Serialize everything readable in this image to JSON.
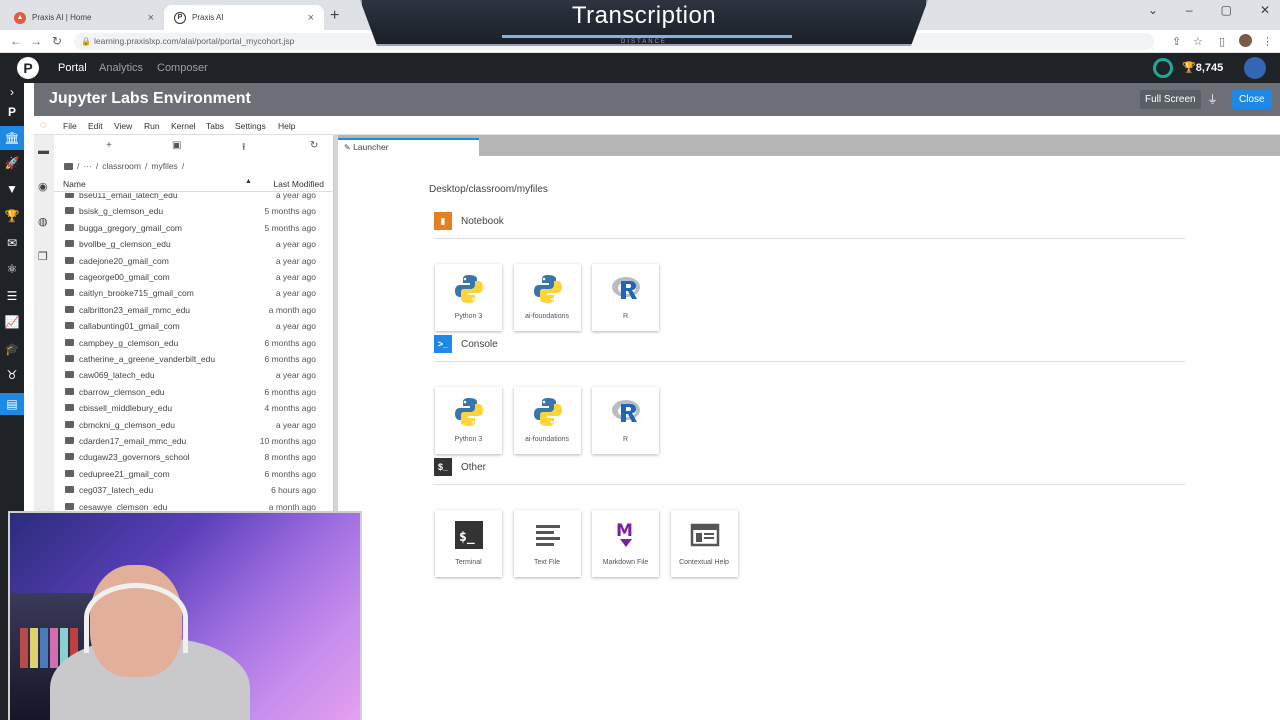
{
  "browser": {
    "tabs": [
      {
        "title": "Praxis AI | Home",
        "active": false
      },
      {
        "title": "Praxis AI",
        "active": true
      }
    ],
    "url": "learning.praxislxp.com/alai/portal/portal_mycohort.jsp"
  },
  "overlay": {
    "title": "Transcription",
    "subtitle": "DISTANCE"
  },
  "portal": {
    "logo": "P",
    "nav": [
      {
        "label": "Portal",
        "active": true
      },
      {
        "label": "Analytics",
        "active": false
      },
      {
        "label": "Composer",
        "active": false
      }
    ],
    "points": "8,745"
  },
  "jupyter": {
    "title": "Jupyter Labs Environment",
    "full_screen_label": "Full Screen",
    "close_label": "Close",
    "menu": [
      "File",
      "Edit",
      "View",
      "Run",
      "Kernel",
      "Tabs",
      "Settings",
      "Help"
    ],
    "breadcrumbs": [
      "/",
      "···",
      "/",
      "classroom",
      "/",
      "myfiles",
      "/"
    ],
    "columns": {
      "name": "Name",
      "modified": "Last Modified"
    },
    "files": [
      {
        "name": "bse011_email_latech_edu",
        "modified": "a year ago"
      },
      {
        "name": "bsisk_g_clemson_edu",
        "modified": "5 months ago"
      },
      {
        "name": "bugga_gregory_gmail_com",
        "modified": "5 months ago"
      },
      {
        "name": "bvollbe_g_clemson_edu",
        "modified": "a year ago"
      },
      {
        "name": "cadejone20_gmail_com",
        "modified": "a year ago"
      },
      {
        "name": "cageorge00_gmail_com",
        "modified": "a year ago"
      },
      {
        "name": "caitlyn_brooke715_gmail_com",
        "modified": "a year ago"
      },
      {
        "name": "calbritton23_email_mmc_edu",
        "modified": "a month ago"
      },
      {
        "name": "callabunting01_gmail_com",
        "modified": "a year ago"
      },
      {
        "name": "campbey_g_clemson_edu",
        "modified": "6 months ago"
      },
      {
        "name": "catherine_a_greene_vanderbilt_edu",
        "modified": "6 months ago"
      },
      {
        "name": "caw069_latech_edu",
        "modified": "a year ago"
      },
      {
        "name": "cbarrow_clemson_edu",
        "modified": "6 months ago"
      },
      {
        "name": "cbissell_middlebury_edu",
        "modified": "4 months ago"
      },
      {
        "name": "cbmckni_g_clemson_edu",
        "modified": "a year ago"
      },
      {
        "name": "cdarden17_email_mmc_edu",
        "modified": "10 months ago"
      },
      {
        "name": "cdugaw23_governors_school",
        "modified": "8 months ago"
      },
      {
        "name": "cedupree21_gmail_com",
        "modified": "6 months ago"
      },
      {
        "name": "ceg037_latech_edu",
        "modified": "6 hours ago"
      },
      {
        "name": "cesawye_clemson_edu",
        "modified": "a month ago"
      }
    ],
    "launcher_tab": "Launcher",
    "launcher_path": "Desktop/classroom/myfiles",
    "sections": [
      {
        "title": "Notebook",
        "color": "#e67e22",
        "cards": [
          {
            "label": "Python 3",
            "icon": "python-icon"
          },
          {
            "label": "ai-foundations",
            "icon": "python-icon"
          },
          {
            "label": "R",
            "icon": "r-icon"
          }
        ]
      },
      {
        "title": "Console",
        "color": "#1e88e5",
        "cards": [
          {
            "label": "Python 3",
            "icon": "python-icon"
          },
          {
            "label": "ai-foundations",
            "icon": "python-icon"
          },
          {
            "label": "R",
            "icon": "r-icon"
          }
        ]
      },
      {
        "title": "Other",
        "color": "#333333",
        "cards": [
          {
            "label": "Terminal",
            "icon": "terminal-icon"
          },
          {
            "label": "Text File",
            "icon": "text-file-icon"
          },
          {
            "label": "Markdown File",
            "icon": "markdown-icon"
          },
          {
            "label": "Contextual Help",
            "icon": "help-icon"
          }
        ]
      }
    ]
  }
}
